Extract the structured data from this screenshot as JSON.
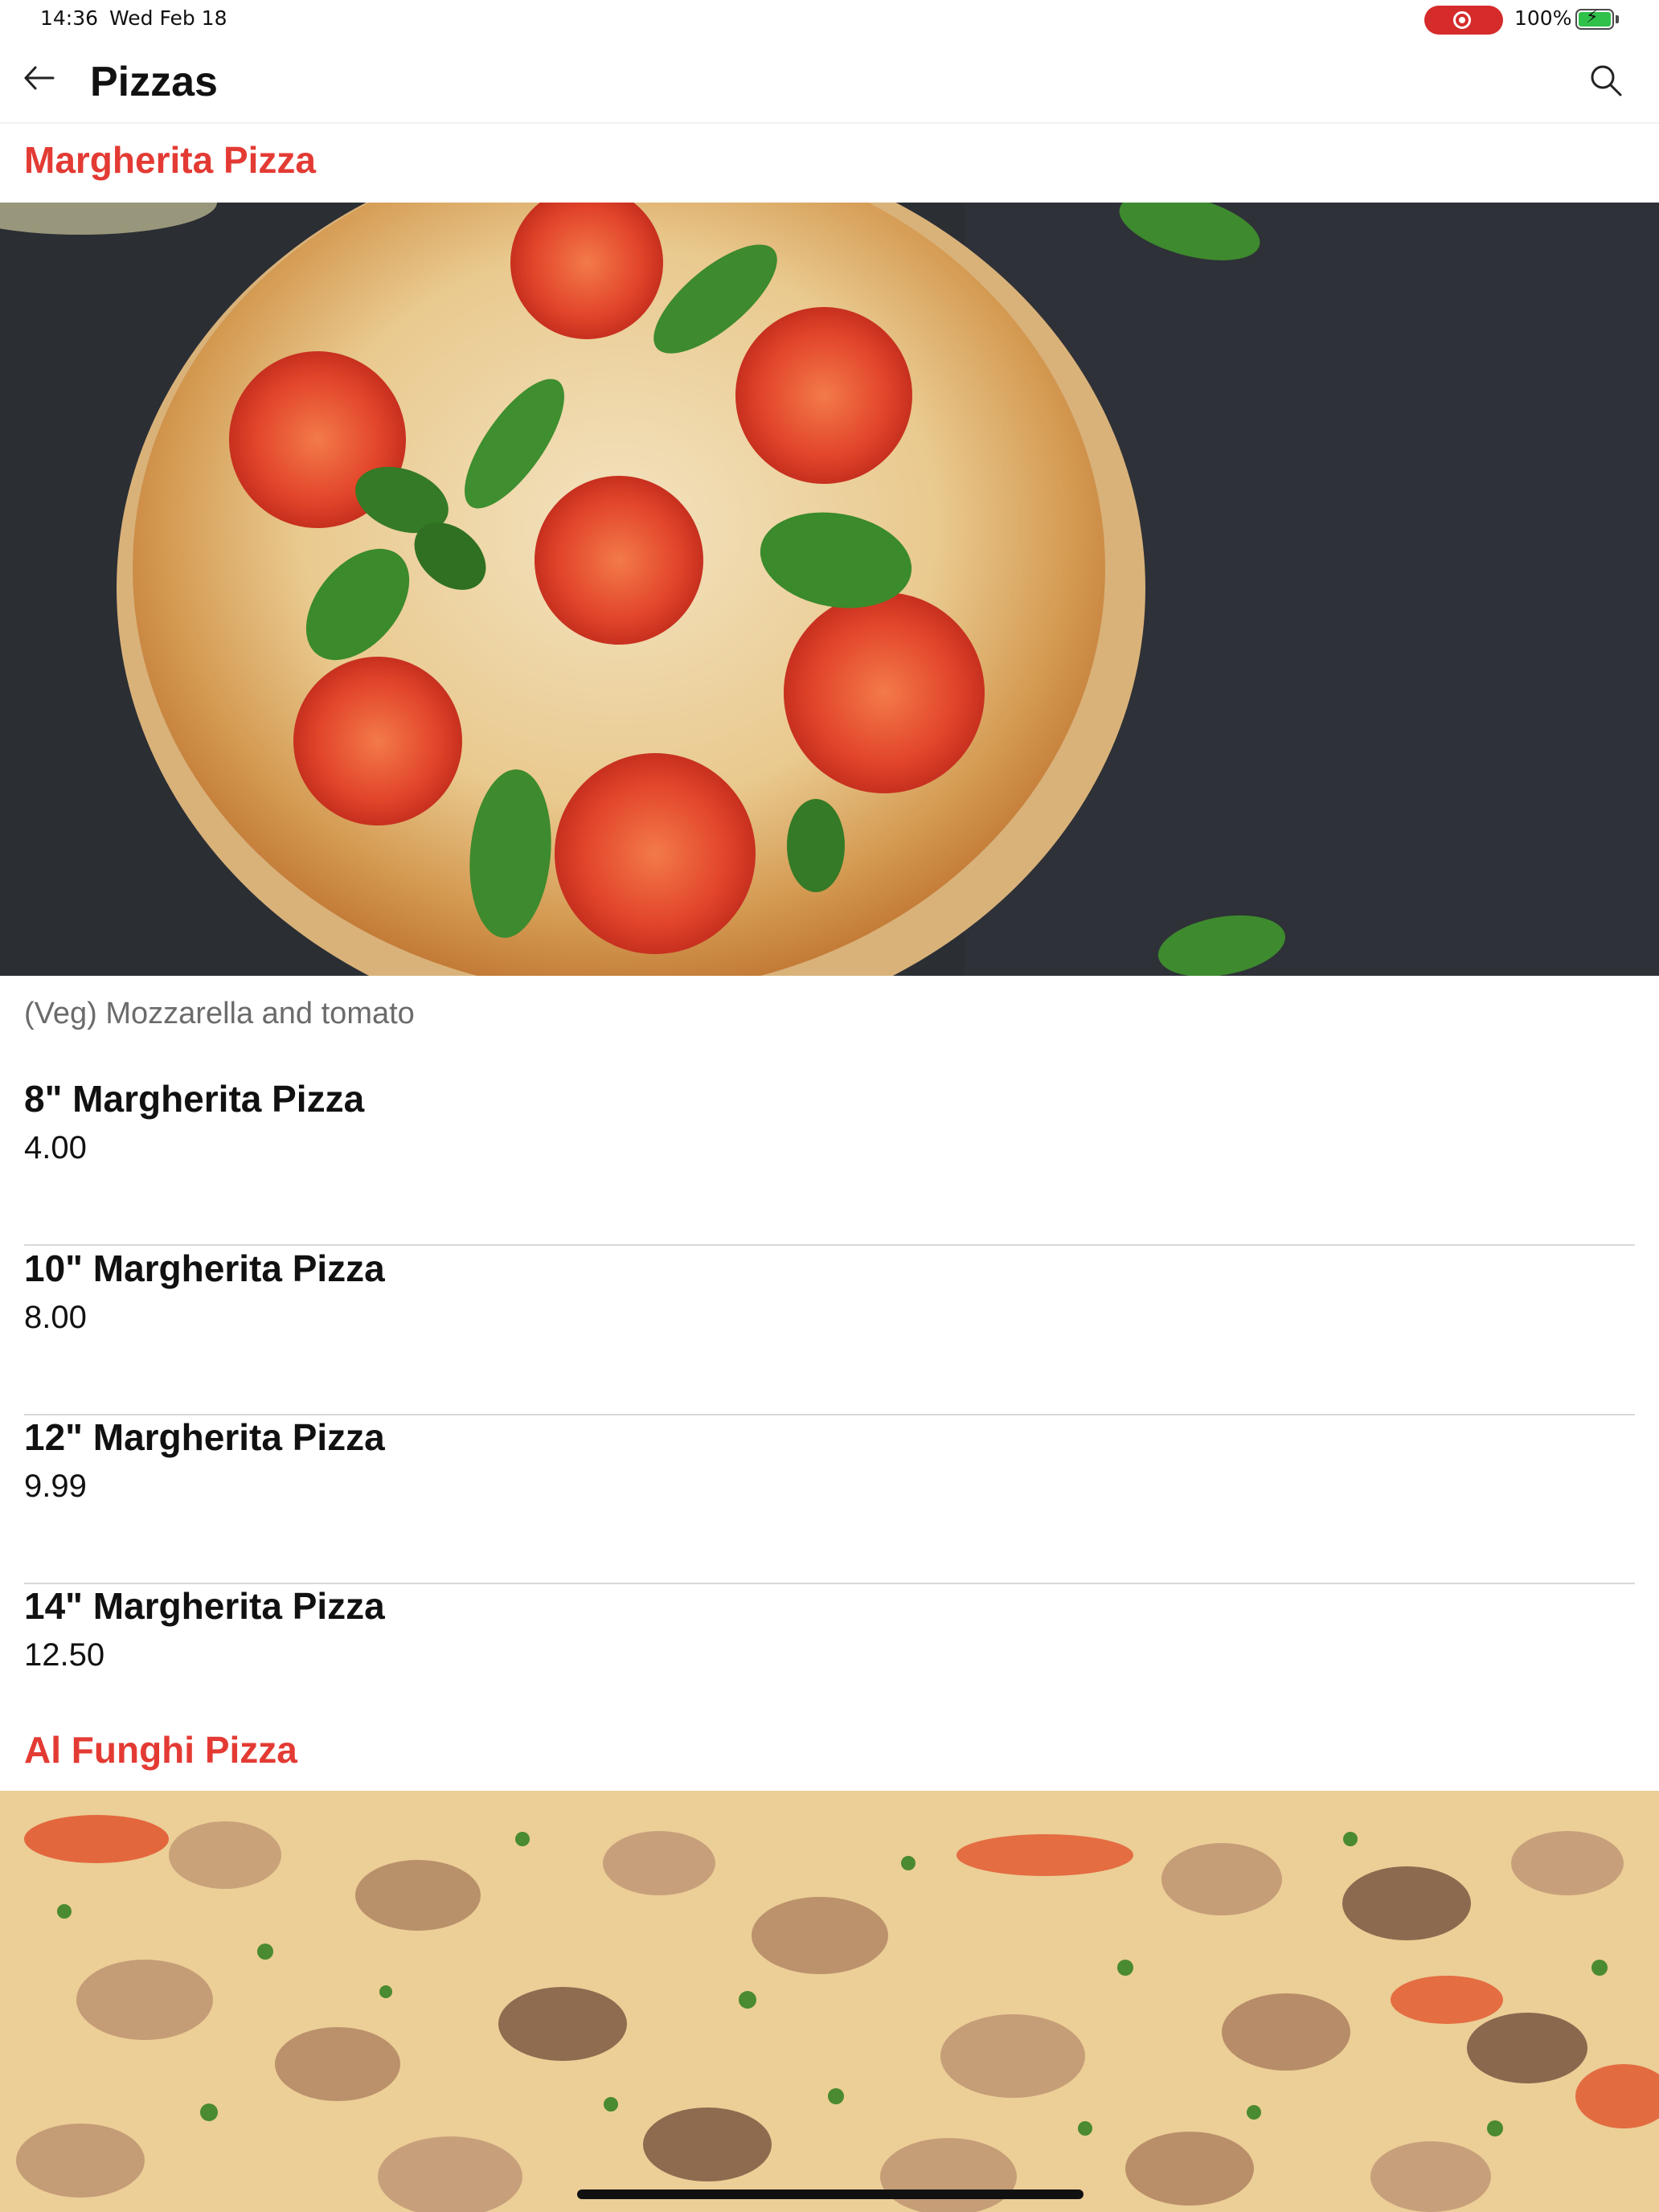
{
  "status_bar": {
    "time": "14:36",
    "date": "Wed Feb 18",
    "battery": "100%"
  },
  "header": {
    "title": "Pizzas",
    "back_icon": "arrow-left-icon",
    "search_icon": "search-icon"
  },
  "sections": [
    {
      "title": "Margherita Pizza",
      "description": "(Veg) Mozzarella and tomato",
      "items": [
        {
          "name": "8\" Margherita Pizza",
          "price": "4.00"
        },
        {
          "name": "10\" Margherita Pizza",
          "price": "8.00"
        },
        {
          "name": "12\" Margherita Pizza",
          "price": "9.99"
        },
        {
          "name": "14\" Margherita Pizza",
          "price": "12.50"
        }
      ]
    },
    {
      "title": "Al Funghi Pizza"
    }
  ],
  "colors": {
    "accent": "#e33b34",
    "divider": "#d8d8d8",
    "subtitle": "#6b6b6b"
  }
}
